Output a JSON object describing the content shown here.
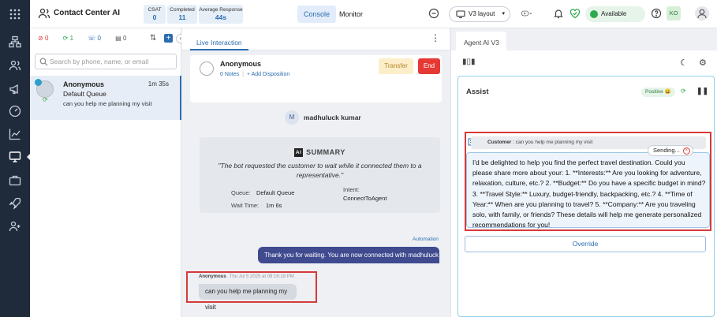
{
  "app": {
    "title": "Contact Center AI"
  },
  "stats": [
    {
      "label": "CSAT",
      "value": "0"
    },
    {
      "label": "Completed",
      "value": "11"
    },
    {
      "label": "Average Response",
      "value": "44s"
    }
  ],
  "top_tabs": {
    "console": "Console",
    "monitor": "Monitor"
  },
  "layout_select": {
    "value": "V3 layout"
  },
  "status": {
    "label": "Available",
    "color": "#2fa84f"
  },
  "user_initials": "KO",
  "counts": {
    "red": "0",
    "green": "1",
    "blue": "0",
    "grey": "0"
  },
  "search": {
    "placeholder": "Search by phone, name, or email"
  },
  "conversation": {
    "name": "Anonymous",
    "time": "1m 35s",
    "queue": "Default Queue",
    "message": "can you help me planning my visit"
  },
  "live": {
    "tab": "Live Interaction",
    "customer_name": "Anonymous",
    "notes": "0 Notes",
    "add_disposition": "+ Add Disposition",
    "transfer": "Transfer",
    "end": "End",
    "agent_initial": "M",
    "agent_name": "madhuluck kumar",
    "summary": {
      "badge": "AI",
      "title": "SUMMARY",
      "quote": "\"The bot requested the customer to wait while it connected them to a representative.\"",
      "queue_key": "Queue:",
      "queue_val": "Default Queue",
      "wait_key": "Wait Time:",
      "wait_val": "1m 6s",
      "intent_key": "Intent:",
      "intent_val": "ConnectToAgent"
    },
    "automation_label": "Automation",
    "bot_message": "Thank you for waiting. You are now connected with madhuluck",
    "user_meta_name": "Anonymous",
    "user_meta_time": "Thu Jul 5 2025 at 08:16:18 PM",
    "user_message": "can you help me planning my visit"
  },
  "agent_ai": {
    "tab": "Agent AI V3",
    "assist_title": "Assist",
    "sentiment": "Positive 😀",
    "customer_label": "Customer",
    "customer_text": ": can you help me planning my visit",
    "sending": "Sending...",
    "suggestion": "I'd be delighted to help you find the perfect travel destination. Could you please share more about your: 1. **Interests:** Are you looking for adventure, relaxation, culture, etc.? 2. **Budget:** Do you have a specific budget in mind? 3. **Travel Style:** Luxury, budget-friendly, backpacking, etc.? 4. **Time of Year:** When are you planning to travel? 5. **Company:** Are you traveling solo, with family, or friends? These details will help me generate personalized recommendations for you!",
    "override": "Override"
  }
}
